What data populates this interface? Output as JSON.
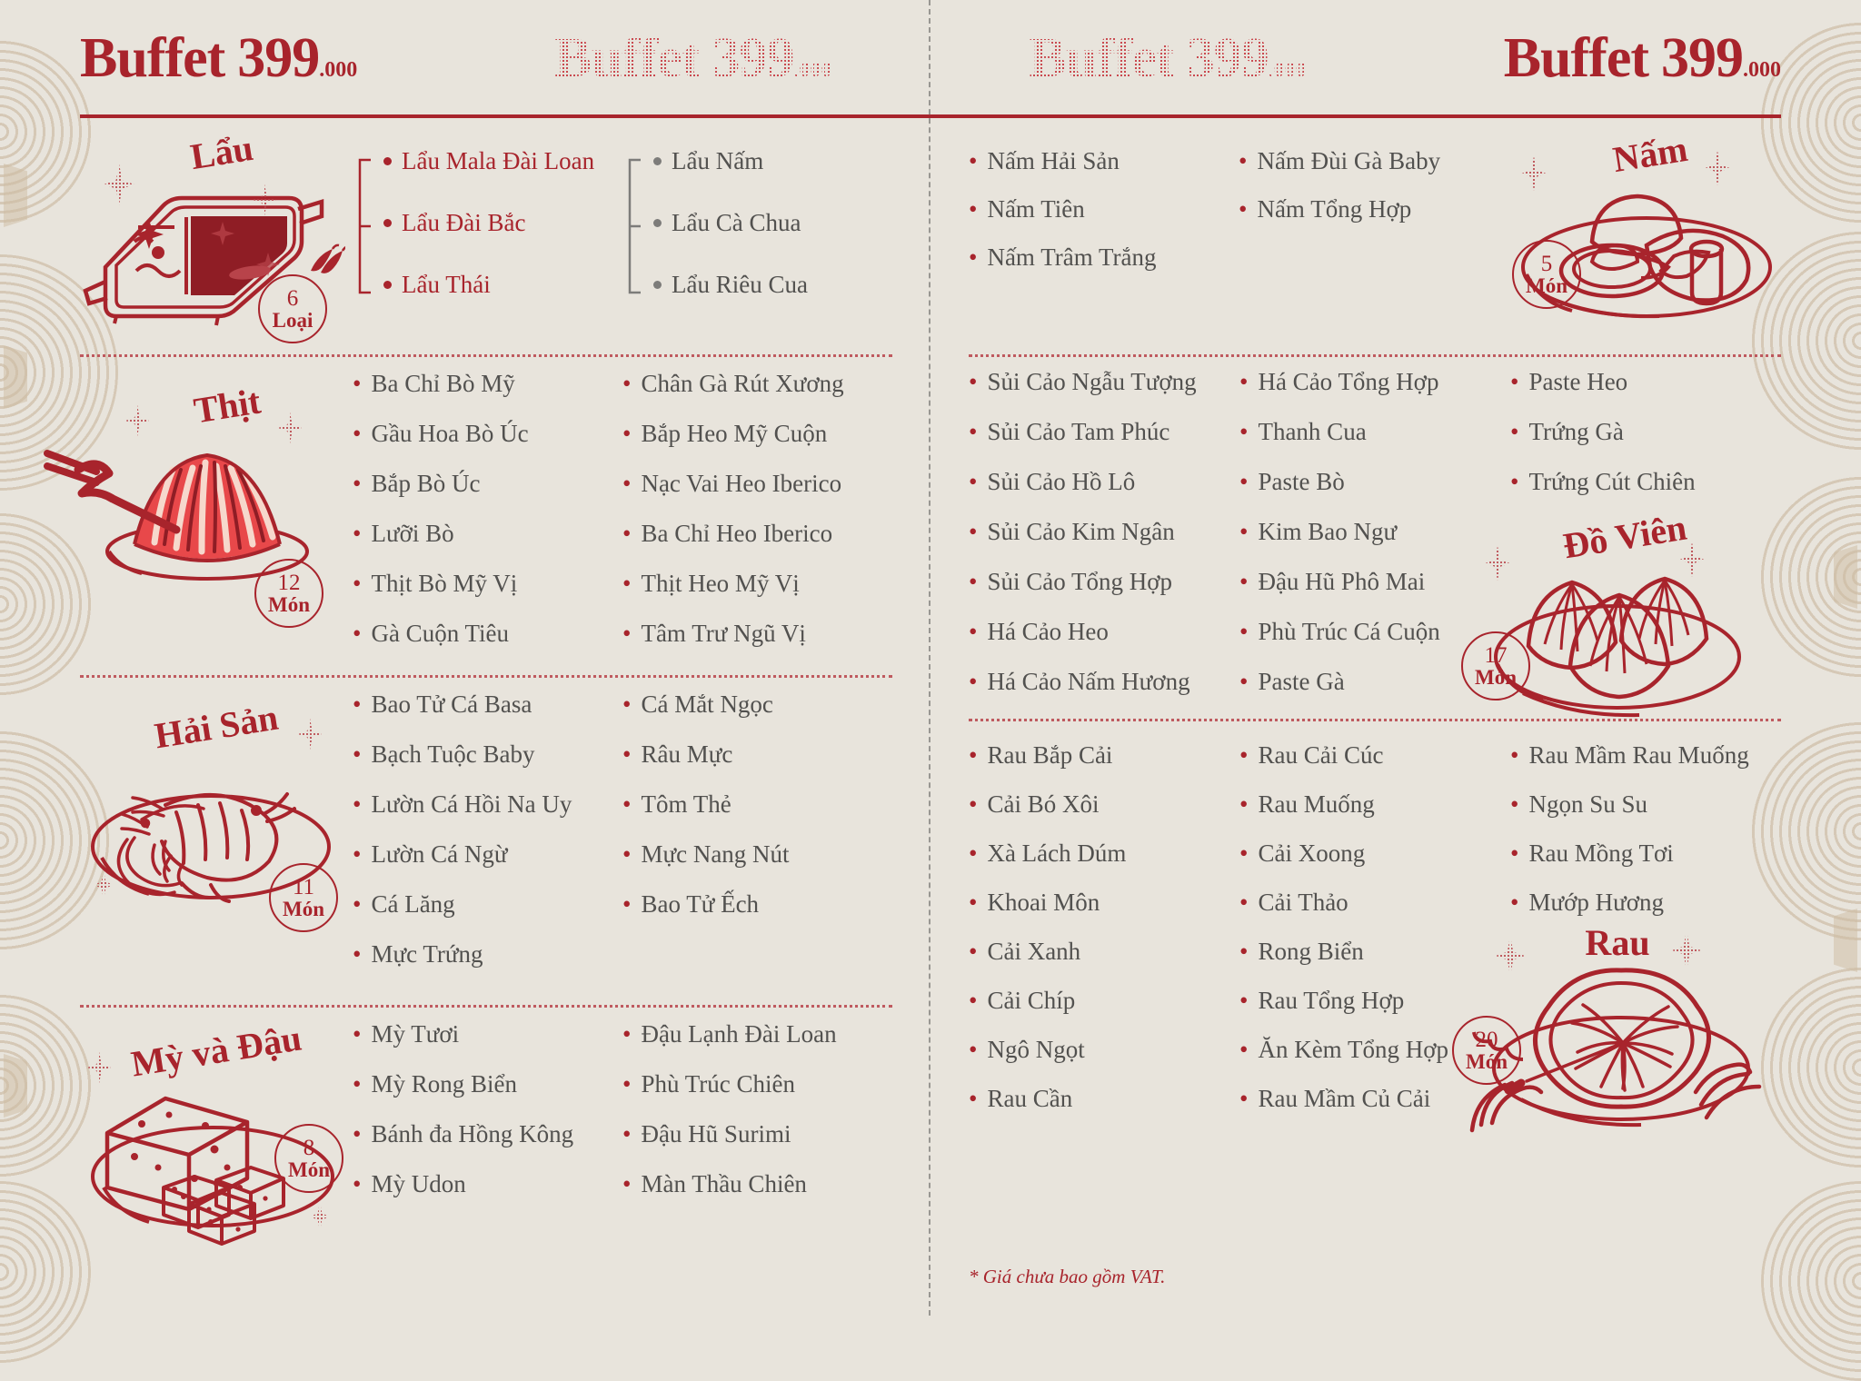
{
  "brand": {
    "word": "Buffet",
    "number": "399",
    "decimals": ".000",
    "repeats": [
      "solid",
      "ghost",
      "ghost",
      "solid"
    ]
  },
  "footnote": "* Giá chưa bao gồm VAT.",
  "sections": {
    "lau": {
      "title": "Lẩu",
      "badge_count": "6",
      "badge_unit": "Loại",
      "icon": "hotpot-illustration",
      "chili_icon": "chili-pepper-icon",
      "group_red": [
        "Lẩu Mala Đài Loan",
        "Lẩu Đài Bắc",
        "Lẩu Thái"
      ],
      "group_grey": [
        "Lẩu Nấm",
        "Lẩu Cà Chua",
        "Lẩu Riêu Cua"
      ]
    },
    "thit": {
      "title": "Thịt",
      "badge_count": "12",
      "badge_unit": "Món",
      "icon": "sliced-meat-illustration",
      "col1": [
        "Ba Chỉ Bò Mỹ",
        "Gầu Hoa Bò Úc",
        "Bắp Bò Úc",
        "Lưỡi Bò",
        "Thịt Bò Mỹ Vị",
        "Gà Cuộn Tiêu"
      ],
      "col2": [
        "Chân Gà Rút Xương",
        "Bắp Heo Mỹ Cuộn",
        "Nạc Vai Heo Iberico",
        "Ba Chỉ Heo Iberico",
        "Thịt Heo Mỹ Vị",
        "Tâm Trư Ngũ Vị"
      ]
    },
    "haisan": {
      "title": "Hải Sản",
      "badge_count": "11",
      "badge_unit": "Món",
      "icon": "shrimp-plate-illustration",
      "col1": [
        "Bao Tử Cá Basa",
        "Bạch Tuộc Baby",
        "Lườn Cá Hồi Na Uy",
        "Lườn Cá Ngừ",
        "Cá Lăng",
        "Mực Trứng"
      ],
      "col2": [
        "Cá Mắt Ngọc",
        "Râu Mực",
        "Tôm Thẻ",
        "Mực Nang Nút",
        "Bao Tử Ếch"
      ]
    },
    "mydau": {
      "title": "Mỳ và Đậu",
      "badge_count": "8",
      "badge_unit": "Món",
      "icon": "tofu-plate-illustration",
      "col1": [
        "Mỳ Tươi",
        "Mỳ Rong Biển",
        "Bánh đa Hồng Kông",
        "Mỳ Udon"
      ],
      "col2": [
        "Đậu Lạnh Đài Loan",
        "Phù Trúc Chiên",
        "Đậu Hũ Surimi",
        "Màn Thầu Chiên"
      ]
    },
    "nam": {
      "title": "Nấm",
      "badge_count": "5",
      "badge_unit": "Món",
      "icon": "mushroom-plate-illustration",
      "col1": [
        "Nấm Hải Sản",
        "Nấm Tiên",
        "Nấm Trâm Trắng"
      ],
      "col2": [
        "Nấm Đùi Gà Baby",
        "Nấm Tổng Hợp"
      ]
    },
    "dovien": {
      "title": "Đồ Viên",
      "badge_count": "17",
      "badge_unit": "Món",
      "icon": "dumpling-plate-illustration",
      "col1": [
        "Sủi Cảo Ngẫu Tượng",
        "Sủi Cảo Tam Phúc",
        "Sủi Cảo Hồ Lô",
        "Sủi Cảo Kim Ngân",
        "Sủi Cảo Tổng Hợp",
        "Há Cảo Heo",
        "Há Cảo Nấm Hương"
      ],
      "col2": [
        "Há Cảo Tổng Hợp",
        "Thanh Cua",
        "Paste Bò",
        "Kim Bao Ngư",
        "Đậu Hũ Phô Mai",
        "Phù Trúc Cá Cuộn",
        "Paste Gà"
      ],
      "col3": [
        "Paste Heo",
        "Trứng Gà",
        "Trứng Cút Chiên"
      ]
    },
    "rau": {
      "title": "Rau",
      "badge_count": "20",
      "badge_unit": "Món",
      "icon": "lettuce-hands-illustration",
      "col1": [
        "Rau Bắp Cải",
        "Cải Bó Xôi",
        "Xà Lách Dúm",
        "Khoai Môn",
        "Cải Xanh",
        "Cải Chíp",
        "Ngô Ngọt",
        "Rau Cần"
      ],
      "col2": [
        "Rau Cải Cúc",
        "Rau Muống",
        "Cải Xoong",
        "Cải Thảo",
        "Rong Biển",
        "Rau Tổng Hợp",
        "Ăn Kèm Tổng Hợp",
        "Rau Mầm Củ Cải"
      ],
      "col3": [
        "Rau Mầm Rau Muống",
        "Ngọn Su Su",
        "Rau Mồng Tơi",
        "Mướp Hương"
      ]
    }
  },
  "colors": {
    "brand_red": "#a8242c",
    "paper": "#e8e4dc",
    "item_text": "#52514f",
    "deco_beige": "#cdbca2"
  }
}
